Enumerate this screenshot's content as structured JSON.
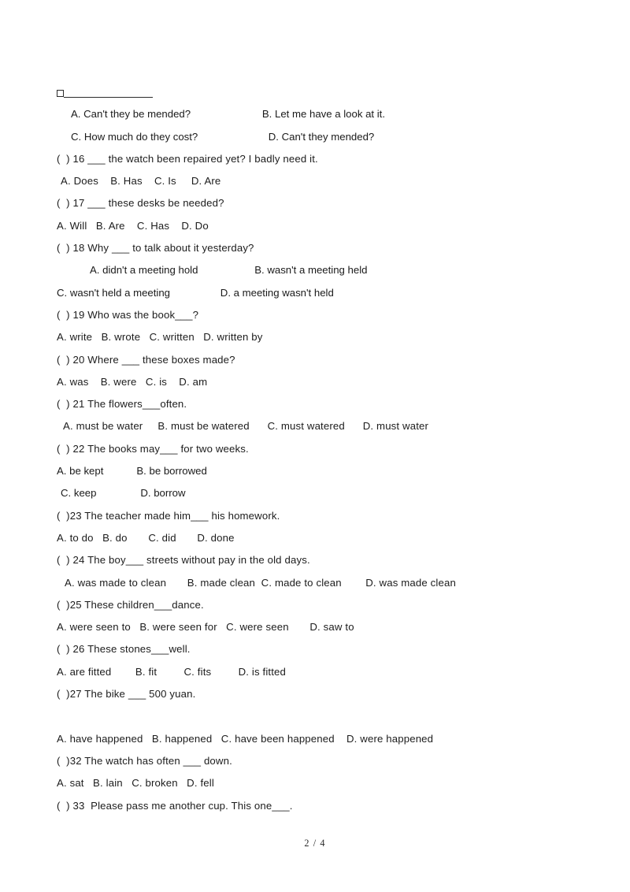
{
  "document": {
    "type": "scanned-exam-page",
    "subject": "English grammar multiple choice (passive voice)",
    "page_label": "2 / 4"
  },
  "stem": {
    "marker_icon": "empty-checkbox-icon",
    "blank_rule": "______________"
  },
  "lines": [
    {
      "id": "l01",
      "indent": 18,
      "text": "A. Can't they be mended?",
      "col2_indent": 260,
      "col2": "B. Let me have a look at it."
    },
    {
      "id": "l02",
      "indent": 18,
      "text": "C. How much do they cost?",
      "col2_indent": 265,
      "col2": "D. Can't they mended?"
    },
    {
      "id": "l03",
      "indent": 0,
      "text": "(  ) 16 ___ the watch been repaired yet? I badly need it."
    },
    {
      "id": "l04",
      "indent": 5,
      "text": "A. Does    B. Has    C. Is     D. Are"
    },
    {
      "id": "l05",
      "indent": 0,
      "text": "(  ) 17 ___ these desks be needed?"
    },
    {
      "id": "l06",
      "indent": 0,
      "text": "A. Will   B. Are    C. Has    D. Do"
    },
    {
      "id": "l07",
      "indent": 0,
      "text": "(  ) 18 Why ___ to talk about it yesterday?"
    },
    {
      "id": "l08",
      "indent": 42,
      "text": "A. didn't a meeting hold",
      "col2_indent": 265,
      "col2": "B. wasn't a meeting held"
    },
    {
      "id": "l09",
      "indent": 0,
      "text": "C. wasn't held a meeting",
      "col2_indent": 215,
      "col2": "D. a meeting wasn't held"
    },
    {
      "id": "l10",
      "indent": 0,
      "text": "(  ) 19 Who was the book___?"
    },
    {
      "id": "l11",
      "indent": 0,
      "text": "A. write   B. wrote   C. written   D. written by"
    },
    {
      "id": "l12",
      "indent": 0,
      "text": "(  ) 20 Where ___ these boxes made?"
    },
    {
      "id": "l13",
      "indent": 0,
      "text": "A. was    B. were   C. is    D. am"
    },
    {
      "id": "l14",
      "indent": 0,
      "text": "(  ) 21 The flowers___often."
    },
    {
      "id": "l15",
      "indent": 8,
      "text": "A. must be water     B. must be watered      C. must watered      D. must water"
    },
    {
      "id": "l16",
      "indent": 0,
      "text": "(  ) 22 The books may___ for two weeks."
    },
    {
      "id": "l17",
      "indent": 0,
      "text": "A. be kept",
      "col2_indent": 105,
      "col2": "B. be borrowed"
    },
    {
      "id": "l18",
      "indent": 5,
      "text": "C. keep",
      "col2_indent": 105,
      "col2": "D. borrow"
    },
    {
      "id": "l19",
      "indent": 0,
      "text": "(  )23 The teacher made him___ his homework."
    },
    {
      "id": "l20",
      "indent": 0,
      "text": "A. to do   B. do       C. did       D. done"
    },
    {
      "id": "l21",
      "indent": 0,
      "text": "(  ) 24 The boy___ streets without pay in the old days."
    },
    {
      "id": "l22",
      "indent": 10,
      "text": "A. was made to clean       B. made clean  C. made to clean        D. was made clean"
    },
    {
      "id": "l23",
      "indent": 0,
      "text": "(  )25 These children___dance."
    },
    {
      "id": "l24",
      "indent": 0,
      "text": "A. were seen to   B. were seen for   C. were seen       D. saw to"
    },
    {
      "id": "l25",
      "indent": 0,
      "text": "(  ) 26 These stones___well."
    },
    {
      "id": "l26",
      "indent": 0,
      "text": "A. are fitted        B. fit         C. fits         D. is fitted"
    },
    {
      "id": "l27",
      "indent": 0,
      "text": "(  )27 The bike ___ 500 yuan."
    },
    {
      "id": "l28",
      "indent": 0,
      "text": "",
      "blank": true
    },
    {
      "id": "l29",
      "indent": 0,
      "text": "A. have happened   B. happened   C. have been happened    D. were happened"
    },
    {
      "id": "l30",
      "indent": 0,
      "text": "(  )32 The watch has often ___ down."
    },
    {
      "id": "l31",
      "indent": 0,
      "text": "A. sat   B. lain   C. broken   D. fell"
    },
    {
      "id": "l32",
      "indent": 0,
      "text": "(  ) 33  Please pass me another cup. This one___."
    }
  ],
  "footer": {
    "page_number": "2 / 4"
  }
}
